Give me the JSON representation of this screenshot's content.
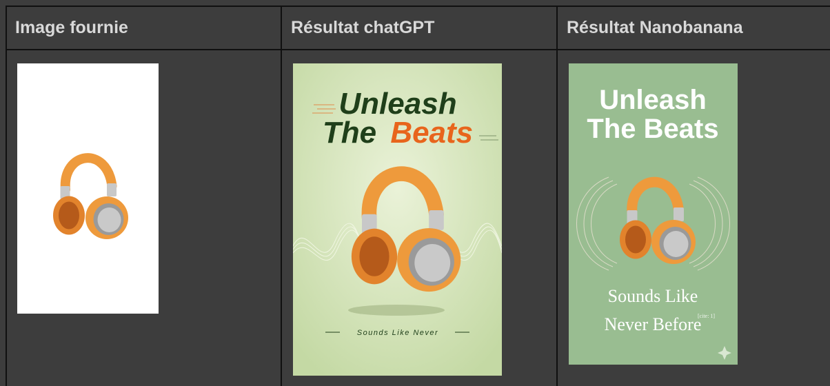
{
  "table": {
    "headers": [
      "Image fournie",
      "Résultat chatGPT",
      "Résultat Nanobanana"
    ]
  },
  "posters": {
    "chatgpt": {
      "line1": "Unleash",
      "line2a": "The",
      "line2b": "Beats",
      "tagline": "Sounds Like Never"
    },
    "nanobanana": {
      "line1": "Unleash",
      "line2": "The Beats",
      "sub1": "Sounds Like",
      "sub2": "Never Before",
      "cite": "[cite: 1]"
    }
  },
  "colors": {
    "background": "#3d3d3d",
    "gridline": "#101010",
    "header_text": "#d9d9d9",
    "chatgpt_bg": "#cfe0b0",
    "chatgpt_title": "#1f3f1a",
    "chatgpt_accent": "#e8651c",
    "nano_bg": "#99bd91",
    "headphone_orange": "#ee9a3c"
  },
  "icons": [
    "headphones-icon",
    "sparkle-icon"
  ]
}
